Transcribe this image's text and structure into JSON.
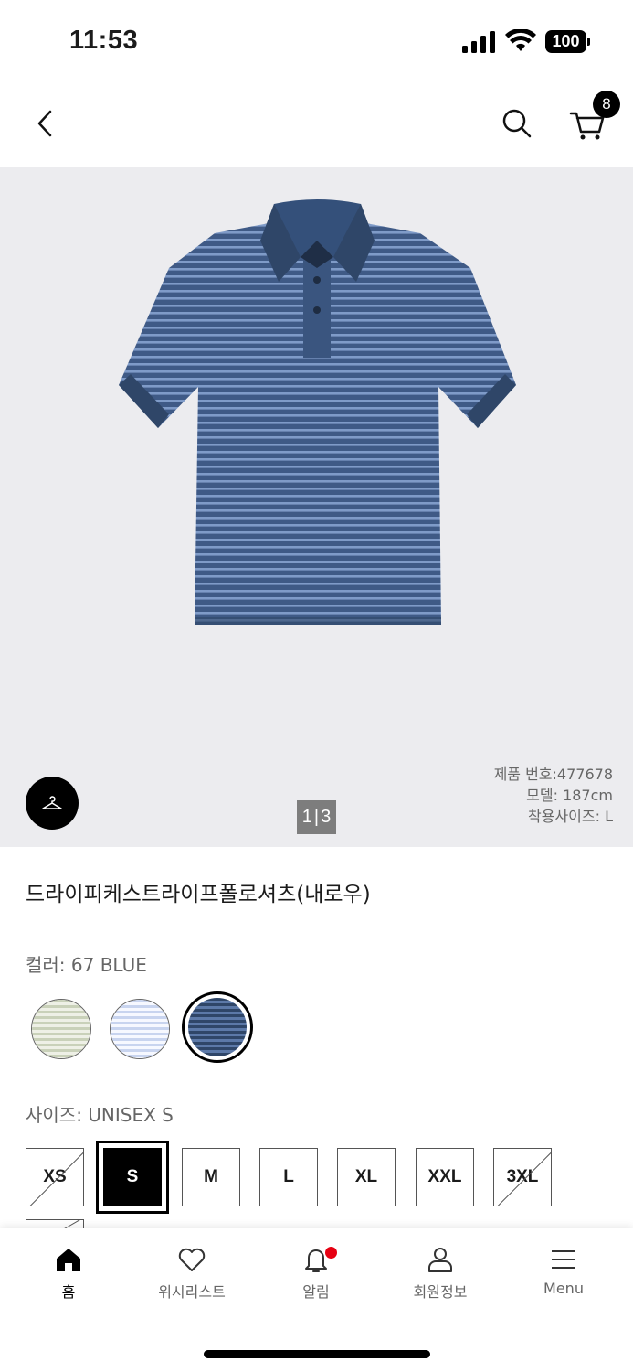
{
  "status_bar": {
    "time": "11:53",
    "battery": "100"
  },
  "header": {
    "cart_count": "8"
  },
  "gallery": {
    "pager_current": "1",
    "pager_total": "3",
    "spec_product_no": "제품 번호:477678",
    "spec_model": "모델: 187cm",
    "spec_size": "착용사이즈: L"
  },
  "product": {
    "title": "드라이피케스트라이프폴로셔츠(내로우)",
    "color_label": "컬러: 67 BLUE",
    "size_label": "사이즈: UNISEX S",
    "colors": [
      "green-stripe",
      "light-blue-stripe",
      "navy-blue-stripe"
    ],
    "sizes": [
      "XS",
      "S",
      "M",
      "L",
      "XL",
      "XXL",
      "3XL"
    ]
  },
  "nav": {
    "home": "홈",
    "wishlist": "위시리스트",
    "alerts": "알림",
    "account": "회원정보",
    "menu": "Menu"
  }
}
